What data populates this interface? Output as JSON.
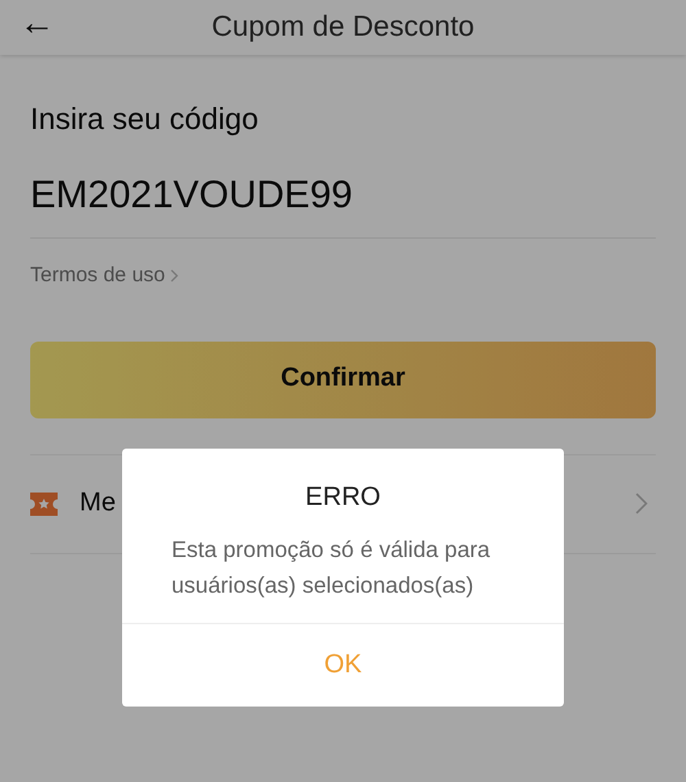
{
  "header": {
    "back_icon": "←",
    "title": "Cupom de Desconto"
  },
  "form": {
    "label": "Insira seu código",
    "code": "EM2021VOUDE99",
    "terms_link": "Termos de uso",
    "confirm_button": "Confirmar"
  },
  "my_coupons_row": {
    "label": "Me"
  },
  "dialog": {
    "title": "ERRO",
    "message": "Esta promoção só é válida para usuários(as) selecionados(as)",
    "ok_button": "OK"
  }
}
